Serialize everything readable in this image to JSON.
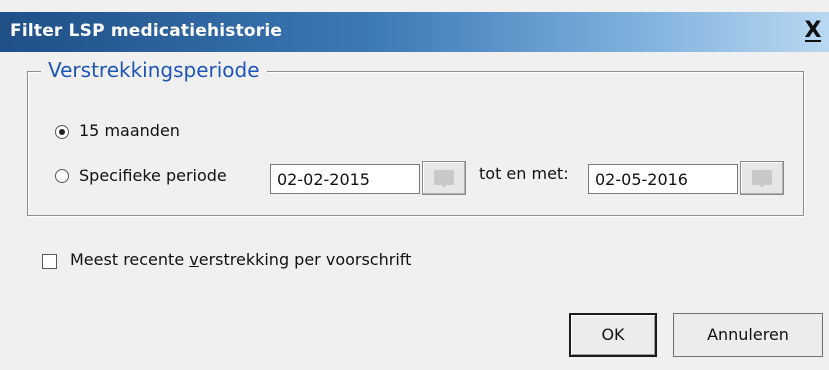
{
  "window": {
    "title": "Filter LSP medicatiehistorie",
    "close_label": "X"
  },
  "group": {
    "legend": "Verstrekkingsperiode"
  },
  "options": {
    "months_label": "15 maanden",
    "months_selected": true,
    "specific_label": "Specifieke periode",
    "specific_selected": false,
    "from_date": "02-02-2015",
    "until_label": "tot en met:",
    "to_date": "02-05-2016"
  },
  "checkbox": {
    "label_pre": "Meest recente ",
    "label_accel": "v",
    "label_post": "erstrekking per voorschrift",
    "checked": false
  },
  "buttons": {
    "ok_label": "OK",
    "cancel_label": "Annuleren"
  },
  "icons": {
    "calendar": "calendar-icon",
    "close": "close-icon"
  }
}
